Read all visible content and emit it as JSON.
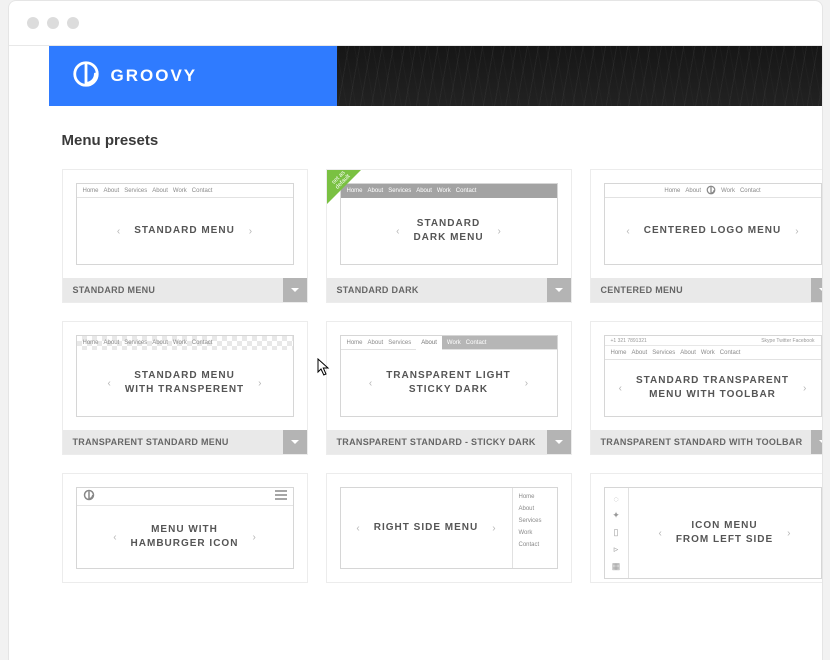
{
  "brand": "GROOVY",
  "section_title": "Menu presets",
  "ribbon": "set as\ndefault",
  "demo_nav": [
    "Home",
    "About",
    "Services",
    "About",
    "Work",
    "Contact"
  ],
  "demo_nav5": [
    "Home",
    "About",
    "Services",
    "Work",
    "Contact"
  ],
  "toolbar": {
    "phone": "+1 321 7891321",
    "social": "Skype  Twitter  Facebook"
  },
  "side_menu": [
    "Home",
    "About",
    "Services",
    "Work",
    "Contact"
  ],
  "side_icons": [
    "drop",
    "compass",
    "box",
    "play",
    "grid"
  ],
  "presets": [
    {
      "title": "STANDARD MENU",
      "caption": "STANDARD MENU"
    },
    {
      "title": "STANDARD\nDARK MENU",
      "caption": "STANDARD DARK"
    },
    {
      "title": "CENTERED LOGO MENU",
      "caption": "CENTERED MENU"
    },
    {
      "title": "STANDARD MENU\nWITH TRANSPERENT",
      "caption": "TRANSPARENT STANDARD MENU"
    },
    {
      "title": "TRANSPARENT LIGHT\nSTICKY DARK",
      "caption": "TRANSPARENT STANDARD - STICKY DARK"
    },
    {
      "title": "STANDARD TRANSPARENT\nMENU WITH TOOLBAR",
      "caption": "TRANSPARENT STANDARD WITH TOOLBAR"
    },
    {
      "title": "MENU WITH\nHAMBURGER ICON",
      "caption": ""
    },
    {
      "title": "RIGHT SIDE MENU",
      "caption": ""
    },
    {
      "title": "ICON MENU\nFROM LEFT SIDE",
      "caption": ""
    }
  ]
}
